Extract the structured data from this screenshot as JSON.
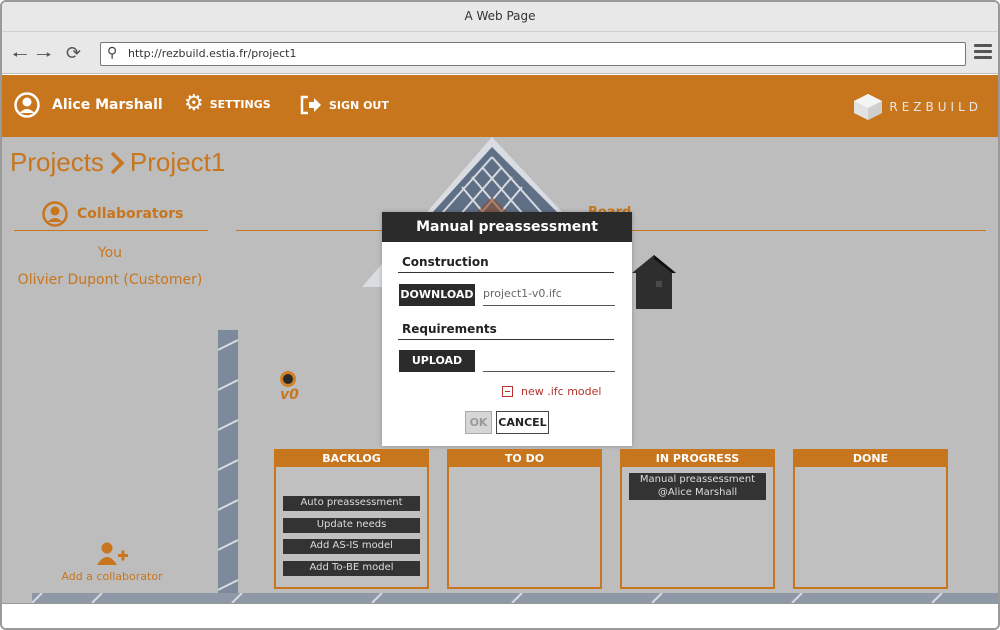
{
  "browser": {
    "title": "A Web Page",
    "url": "http://rezbuild.estia.fr/project1"
  },
  "header": {
    "user_name": "Alice Marshall",
    "settings_label": "SETTINGS",
    "signout_label": "SIGN OUT",
    "logo_text": "REZBUILD",
    "accent_color": "#c8761e"
  },
  "breadcrumb": {
    "root": "Projects",
    "current": "Project1"
  },
  "collaborators": {
    "title": "Collaborators",
    "items": [
      "You",
      "Olivier Dupont (Customer)"
    ],
    "add_label": "Add a collaborator"
  },
  "board": {
    "label": "Board",
    "version": "v0",
    "columns": [
      {
        "title": "BACKLOG",
        "tasks": [
          "Auto preassessment",
          "Update needs",
          "Add AS-IS model",
          "Add To-BE model"
        ]
      },
      {
        "title": "TO DO",
        "tasks": []
      },
      {
        "title": "IN PROGRESS",
        "tasks": [
          {
            "line1": "Manual preassessment",
            "line2": "@Alice Marshall"
          }
        ]
      },
      {
        "title": "DONE",
        "tasks": []
      }
    ]
  },
  "modal": {
    "title": "Manual preassessment",
    "construction_label": "Construction",
    "download_label": "DOWNLOAD",
    "download_file": "project1-v0.ifc",
    "requirements_label": "Requirements",
    "upload_label": "UPLOAD",
    "upload_file": "",
    "new_model_label": "new .ifc model",
    "ok_label": "OK",
    "cancel_label": "CANCEL"
  }
}
